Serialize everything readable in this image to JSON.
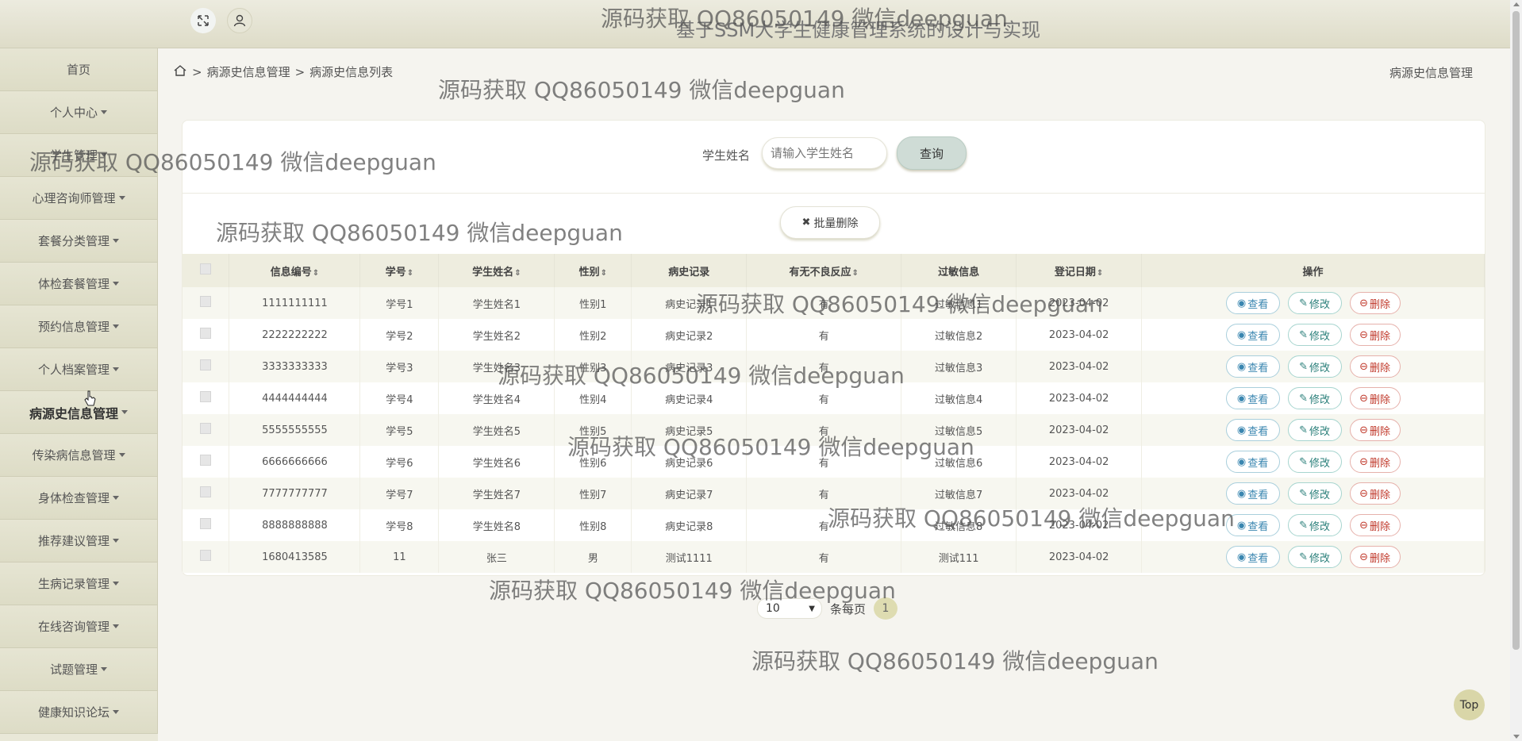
{
  "app_title": "基于SSM大学生健康管理系统的设计与实现",
  "sidebar": {
    "items": [
      {
        "label": "首页",
        "has_caret": false
      },
      {
        "label": "个人中心",
        "has_caret": true
      },
      {
        "label": "学生管理",
        "has_caret": true
      },
      {
        "label": "心理咨询师管理",
        "has_caret": true
      },
      {
        "label": "套餐分类管理",
        "has_caret": true
      },
      {
        "label": "体检套餐管理",
        "has_caret": true
      },
      {
        "label": "预约信息管理",
        "has_caret": true
      },
      {
        "label": "个人档案管理",
        "has_caret": true
      },
      {
        "label": "病源史信息管理",
        "has_caret": true,
        "active": true
      },
      {
        "label": "传染病信息管理",
        "has_caret": true
      },
      {
        "label": "身体检查管理",
        "has_caret": true
      },
      {
        "label": "推荐建议管理",
        "has_caret": true
      },
      {
        "label": "生病记录管理",
        "has_caret": true
      },
      {
        "label": "在线咨询管理",
        "has_caret": true
      },
      {
        "label": "试题管理",
        "has_caret": true
      },
      {
        "label": "健康知识论坛",
        "has_caret": true
      }
    ]
  },
  "breadcrumb": {
    "sep": ">",
    "level1": "病源史信息管理",
    "level2": "病源史信息列表",
    "right_label": "病源史信息管理"
  },
  "search": {
    "label": "学生姓名",
    "placeholder": "请输入学生姓名",
    "button": "查询"
  },
  "bulk_delete_label": "批量删除",
  "table": {
    "headers": [
      "信息编号",
      "学号",
      "学生姓名",
      "性别",
      "病史记录",
      "有无不良反应",
      "过敏信息",
      "登记日期",
      "操作"
    ],
    "rows": [
      [
        "1111111111",
        "学号1",
        "学生姓名1",
        "性别1",
        "病史记录1",
        "有",
        "过敏信息1",
        "2023-04-02"
      ],
      [
        "2222222222",
        "学号2",
        "学生姓名2",
        "性别2",
        "病史记录2",
        "有",
        "过敏信息2",
        "2023-04-02"
      ],
      [
        "3333333333",
        "学号3",
        "学生姓名3",
        "性别3",
        "病史记录3",
        "有",
        "过敏信息3",
        "2023-04-02"
      ],
      [
        "4444444444",
        "学号4",
        "学生姓名4",
        "性别4",
        "病史记录4",
        "有",
        "过敏信息4",
        "2023-04-02"
      ],
      [
        "5555555555",
        "学号5",
        "学生姓名5",
        "性别5",
        "病史记录5",
        "有",
        "过敏信息5",
        "2023-04-02"
      ],
      [
        "6666666666",
        "学号6",
        "学生姓名6",
        "性别6",
        "病史记录6",
        "有",
        "过敏信息6",
        "2023-04-02"
      ],
      [
        "7777777777",
        "学号7",
        "学生姓名7",
        "性别7",
        "病史记录7",
        "有",
        "过敏信息7",
        "2023-04-02"
      ],
      [
        "8888888888",
        "学号8",
        "学生姓名8",
        "性别8",
        "病史记录8",
        "有",
        "过敏信息8",
        "2023-04-02"
      ],
      [
        "1680413585",
        "11",
        "张三",
        "男",
        "测试1111",
        "有",
        "测试111",
        "2023-04-02"
      ]
    ],
    "actions": {
      "view": "查看",
      "edit": "修改",
      "delete": "删除"
    }
  },
  "pagination": {
    "page_size": "10",
    "per_page_label": "条每页",
    "current_page": "1"
  },
  "top_button": "Top",
  "watermark": "源码获取 QQ86050149 微信deepguan",
  "colors": {
    "header_bg": "#e4e2cf",
    "sidebar_bg": "#e2e1cd",
    "accent": "#dedcb1",
    "view": "#3a86b0",
    "edit": "#2a7f7a",
    "delete": "#c0392b"
  }
}
